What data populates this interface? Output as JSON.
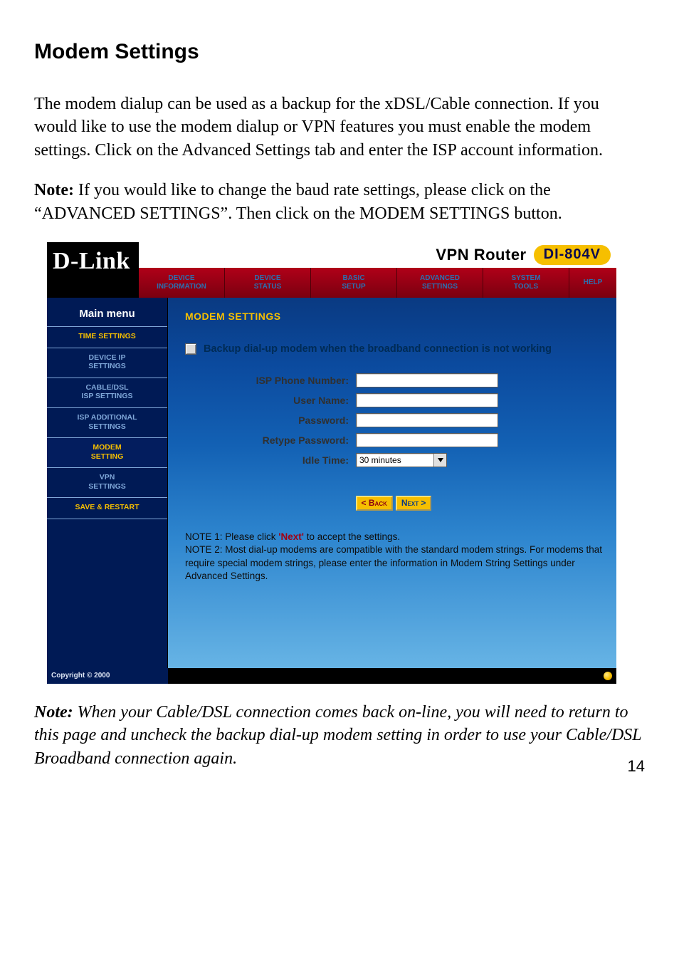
{
  "doc": {
    "title": "Modem Settings",
    "para1": "The modem dialup can be used as a backup for the xDSL/Cable connection. If you would like to use the modem dialup or VPN features you must enable the modem settings. Click on the Advanced Settings tab and enter the ISP account information.",
    "note_label": "Note:",
    "note_body": " If you would like to change the baud rate settings, please click on the “ADVANCED SETTINGS”. Then click on the MODEM SETTINGS button.",
    "note2_label": "Note:",
    "note2_body": " When your Cable/DSL connection comes back on-line, you will need to return to this page and uncheck the backup dial-up modem setting in order to use your Cable/DSL Broadband connection again.",
    "page_number": "14"
  },
  "logo": "D-Link",
  "product": {
    "title": "VPN Router",
    "model": "DI-804V"
  },
  "tabs": [
    {
      "line1": "DEVICE",
      "line2": "INFORMATION"
    },
    {
      "line1": "DEVICE",
      "line2": "STATUS"
    },
    {
      "line1": "BASIC",
      "line2": "SETUP"
    },
    {
      "line1": "ADVANCED",
      "line2": "SETTINGS"
    },
    {
      "line1": "SYSTEM",
      "line2": "TOOLS"
    },
    {
      "line1": "HELP",
      "line2": ""
    }
  ],
  "sidebar": {
    "heading": "Main menu",
    "items": [
      {
        "label": "TIME SETTINGS",
        "tone": "orange"
      },
      {
        "label": "DEVICE IP\nSETTINGS",
        "tone": "blue"
      },
      {
        "label": "CABLE/DSL\nISP SETTINGS",
        "tone": "blue"
      },
      {
        "label": "ISP ADDITIONAL\nSETTINGS",
        "tone": "blue"
      },
      {
        "label": "MODEM\nSETTING",
        "tone": "orange"
      },
      {
        "label": "VPN\nSETTINGS",
        "tone": "blue"
      },
      {
        "label": "SAVE & RESTART",
        "tone": "orange"
      }
    ]
  },
  "panel": {
    "title": "MODEM SETTINGS",
    "checkbox_label": "Backup dial-up modem when the broadband connection is not working",
    "fields": {
      "isp_phone": {
        "label": "ISP Phone Number:",
        "value": ""
      },
      "user_name": {
        "label": "User Name:",
        "value": ""
      },
      "password": {
        "label": "Password:",
        "value": ""
      },
      "retype_pwd": {
        "label": "Retype Password:",
        "value": ""
      },
      "idle_time": {
        "label": "Idle Time:",
        "value": "30 minutes"
      }
    },
    "buttons": {
      "back": "< Back",
      "next": "Next >"
    },
    "note1_pre": "NOTE 1: Please click ",
    "note1_next": "'Next'",
    "note1_post": " to accept the settings.",
    "note2": "NOTE 2: Most dial-up modems are compatible with the standard modem strings. For modems that require special modem strings, please enter the information in Modem String Settings under Advanced Settings."
  },
  "copyright": "Copyright © 2000"
}
